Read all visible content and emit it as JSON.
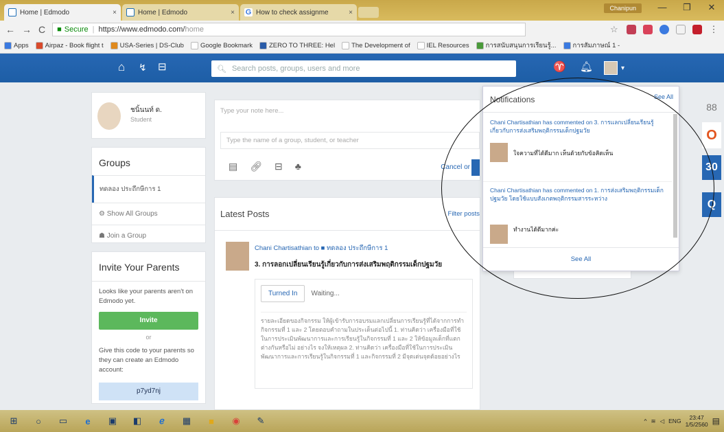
{
  "browser": {
    "tabs": [
      {
        "title": "Home | Edmodo",
        "close": "×"
      },
      {
        "title": "Home | Edmodo",
        "close": "×"
      },
      {
        "title": "How to check assignme",
        "close": "×"
      }
    ],
    "window_user": "Chanipun",
    "controls": [
      "—",
      "❐",
      "✕"
    ],
    "nav": {
      "back": "←",
      "forward": "→",
      "reload": "C"
    },
    "address": {
      "secure": "Secure",
      "sep": "|",
      "url": "https://www.edmodo.com/",
      "path": "home"
    },
    "bookmarks": [
      {
        "label": "Apps",
        "color": "#3b7ae0"
      },
      {
        "label": "Airpaz - Book flight t",
        "color": "#d94a2b"
      },
      {
        "label": "USA-Series | DS-Club",
        "color": "#e08a1e"
      },
      {
        "label": "Google Bookmark",
        "color": "#ffffff"
      },
      {
        "label": "ZERO TO THREE: Hel",
        "color": "#2a5ca8"
      },
      {
        "label": "The Development of",
        "color": "#ffffff"
      },
      {
        "label": "IEL Resources",
        "color": "#ffffff"
      },
      {
        "label": "การสนับสนุนการเรียนรู้...",
        "color": "#4a9a3a"
      },
      {
        "label": "การสัมภาษณ์ 1 -",
        "color": "#3b7ae0"
      }
    ]
  },
  "edmodo": {
    "search_placeholder": "Search posts, groups, users and more",
    "profile": {
      "name": "ชนิ้นนท์ ด.",
      "role": "Student"
    },
    "groups": {
      "title": "Groups",
      "active": "ทดลอง ประถึกษีการ 1",
      "show_all": "Show All Groups",
      "join": "Join a Group"
    },
    "invite": {
      "title": "Invite Your Parents",
      "text1": "Looks like your parents aren't on Edmodo yet.",
      "button": "Invite",
      "or": "or",
      "text2": "Give this code to your parents so they can create an Edmodo account:",
      "code": "p7yd7nj"
    },
    "composer": {
      "note_placeholder": "Type your note here...",
      "to_placeholder": "Type the name of a group, student, or teacher",
      "cancel": "Cancel or"
    },
    "posts": {
      "title": "Latest Posts",
      "filter": "Filter posts",
      "by": "Chani Chartisathian to ■ ทดลอง ประถึกษีการ 1",
      "post_title": "3. การลอกเปลี่ยนเรียนรู้เกี่ยวกับการส่งเสริมพฤติกรรมเด็กปฐมวัย",
      "turned_in": "Turned In",
      "waiting": "Waiting...",
      "desc": "รายละเอียดของกิจกรรม ให้ผู้เข้ารับการอบรมแลกเปลี่ยนการเรียนรู้ที่ได้จากการทำกิจกรรมที่ 1 และ 2 โดยตอบคำถามในประเด็นต่อไปนี้ 1. ท่านคิดว่า เครื่องมือที่ใช้ในการประเมินพัฒนาการและการเรียนรู้ในกิจกรรมที่ 1 และ 2 ให้ข้อมูลเด็กที่แตกต่างกันหรือไม่ อย่างไร จงให้เหตุผล 2. ท่านคิดว่า เครื่องมือที่ใช้ในการประเมินพัฒนาการและการเรียนรู้ในกิจกรรมที่ 1 และกิจกรรมที่ 2 มีจุดเด่นจุดด้อยอย่างไร"
    },
    "notifications": {
      "title": "Notifications",
      "see_all_top": "See All",
      "items": [
        {
          "text": "Chani Chartisathian has commented on 3. การแลกเปลี่ยนเรียนรู้เกี่ยวกับการส่งเสริมพฤติกรรมเด็กปฐมวัย",
          "message": "ใจความที่ได้ดีมาก เห็นด้วยกับข้อคิดเห็น"
        },
        {
          "text": "Chani Chartisathian has commented on 1. การส่งเสริมพฤติกรรมเด็กปฐมวัย โดยใช้แบบสังเกตพฤติกรรมสารระหว่าง",
          "message": "ทำงานได้ดีมากค่ะ"
        }
      ],
      "see_all": "See All"
    },
    "side_apps": [
      "88",
      "O",
      "30",
      "Q"
    ]
  },
  "taskbar": {
    "lang": "ENG",
    "time": "23:47",
    "date": "1/5/2560"
  }
}
